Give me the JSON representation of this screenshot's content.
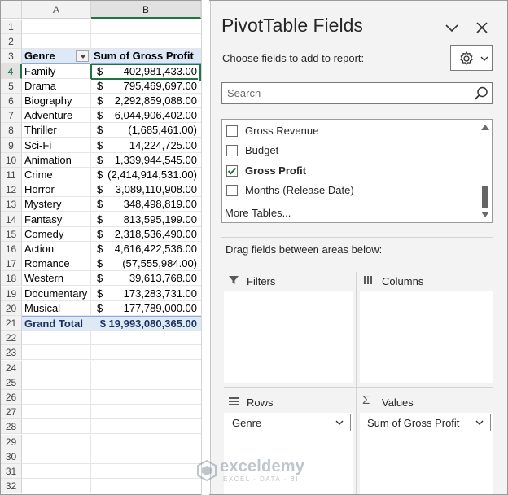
{
  "spreadsheet": {
    "columns": [
      "A",
      "B"
    ],
    "rows": [
      {
        "n": "1",
        "a": "",
        "cur": "",
        "b": ""
      },
      {
        "n": "2",
        "a": "",
        "cur": "",
        "b": ""
      },
      {
        "n": "3",
        "a": "Genre",
        "cur": "",
        "b": "Sum of Gross Profit",
        "type": "header"
      },
      {
        "n": "4",
        "a": "Family",
        "cur": "$",
        "b": "402,981,433.00",
        "type": "data",
        "active": true
      },
      {
        "n": "5",
        "a": "Drama",
        "cur": "$",
        "b": "795,469,697.00",
        "type": "data"
      },
      {
        "n": "6",
        "a": "Biography",
        "cur": "$",
        "b": "2,292,859,088.00",
        "type": "data"
      },
      {
        "n": "7",
        "a": "Adventure",
        "cur": "$",
        "b": "6,044,906,402.00",
        "type": "data"
      },
      {
        "n": "8",
        "a": "Thriller",
        "cur": "$",
        "b": "(1,685,461.00)",
        "type": "data"
      },
      {
        "n": "9",
        "a": "Sci-Fi",
        "cur": "$",
        "b": "14,224,725.00",
        "type": "data"
      },
      {
        "n": "10",
        "a": "Animation",
        "cur": "$",
        "b": "1,339,944,545.00",
        "type": "data"
      },
      {
        "n": "11",
        "a": "Crime",
        "cur": "$",
        "b": "(2,414,914,531.00)",
        "type": "data"
      },
      {
        "n": "12",
        "a": "Horror",
        "cur": "$",
        "b": "3,089,110,908.00",
        "type": "data"
      },
      {
        "n": "13",
        "a": "Mystery",
        "cur": "$",
        "b": "348,498,819.00",
        "type": "data"
      },
      {
        "n": "14",
        "a": "Fantasy",
        "cur": "$",
        "b": "813,595,199.00",
        "type": "data"
      },
      {
        "n": "15",
        "a": "Comedy",
        "cur": "$",
        "b": "2,318,536,490.00",
        "type": "data"
      },
      {
        "n": "16",
        "a": "Action",
        "cur": "$",
        "b": "4,616,422,536.00",
        "type": "data"
      },
      {
        "n": "17",
        "a": "Romance",
        "cur": "$",
        "b": "(57,555,984.00)",
        "type": "data"
      },
      {
        "n": "18",
        "a": "Western",
        "cur": "$",
        "b": "39,613,768.00",
        "type": "data"
      },
      {
        "n": "19",
        "a": "Documentary",
        "cur": "$",
        "b": "173,283,731.00",
        "type": "data"
      },
      {
        "n": "20",
        "a": "Musical",
        "cur": "$",
        "b": "177,789,000.00",
        "type": "data"
      },
      {
        "n": "21",
        "a": "Grand Total",
        "cur": "",
        "b": "$ 19,993,080,365.00",
        "type": "total"
      },
      {
        "n": "22",
        "a": "",
        "cur": "",
        "b": ""
      },
      {
        "n": "23",
        "a": "",
        "cur": "",
        "b": ""
      },
      {
        "n": "24",
        "a": "",
        "cur": "",
        "b": ""
      },
      {
        "n": "25",
        "a": "",
        "cur": "",
        "b": ""
      },
      {
        "n": "26",
        "a": "",
        "cur": "",
        "b": ""
      },
      {
        "n": "27",
        "a": "",
        "cur": "",
        "b": ""
      },
      {
        "n": "28",
        "a": "",
        "cur": "",
        "b": ""
      },
      {
        "n": "29",
        "a": "",
        "cur": "",
        "b": ""
      },
      {
        "n": "30",
        "a": "",
        "cur": "",
        "b": ""
      },
      {
        "n": "31",
        "a": "",
        "cur": "",
        "b": ""
      },
      {
        "n": "32",
        "a": "",
        "cur": "",
        "b": ""
      }
    ]
  },
  "panel": {
    "title": "PivotTable Fields",
    "subtitle": "Choose fields to add to report:",
    "search_placeholder": "Search",
    "fields": [
      {
        "label": "Gross Revenue",
        "checked": false
      },
      {
        "label": "Budget",
        "checked": false
      },
      {
        "label": "Gross Profit",
        "checked": true
      },
      {
        "label": "Months (Release Date)",
        "checked": false
      }
    ],
    "more_tables": "More Tables...",
    "drag_label": "Drag fields between areas below:",
    "areas": {
      "filters": "Filters",
      "columns": "Columns",
      "rows": "Rows",
      "values": "Values",
      "rows_item": "Genre",
      "values_item": "Sum of Gross Profit"
    }
  },
  "watermark": {
    "title": "exceldemy",
    "subtitle": "EXCEL · DATA · BI"
  },
  "colors": {
    "accent": "#217346",
    "pivot_header": "#dde9f7",
    "check": "#217346"
  }
}
